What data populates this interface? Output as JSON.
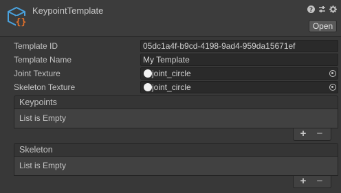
{
  "header": {
    "title": "KeypointTemplate",
    "open_label": "Open",
    "icons": [
      "help-icon",
      "presets-icon",
      "settings-icon"
    ]
  },
  "fields": [
    {
      "label": "Template ID",
      "value": "05dc1a4f-b9cd-4198-9ad4-959da15671ef"
    },
    {
      "label": "Template Name",
      "value": "My Template"
    },
    {
      "label": "Joint Texture",
      "value": "joint_circle"
    },
    {
      "label": "Skeleton Texture",
      "value": "joint_circle"
    }
  ],
  "lists": [
    {
      "title": "Keypoints",
      "empty_text": "List is Empty",
      "add": "+",
      "remove": "−"
    },
    {
      "title": "Skeleton",
      "empty_text": "List is Empty",
      "add": "+",
      "remove": "−"
    }
  ]
}
